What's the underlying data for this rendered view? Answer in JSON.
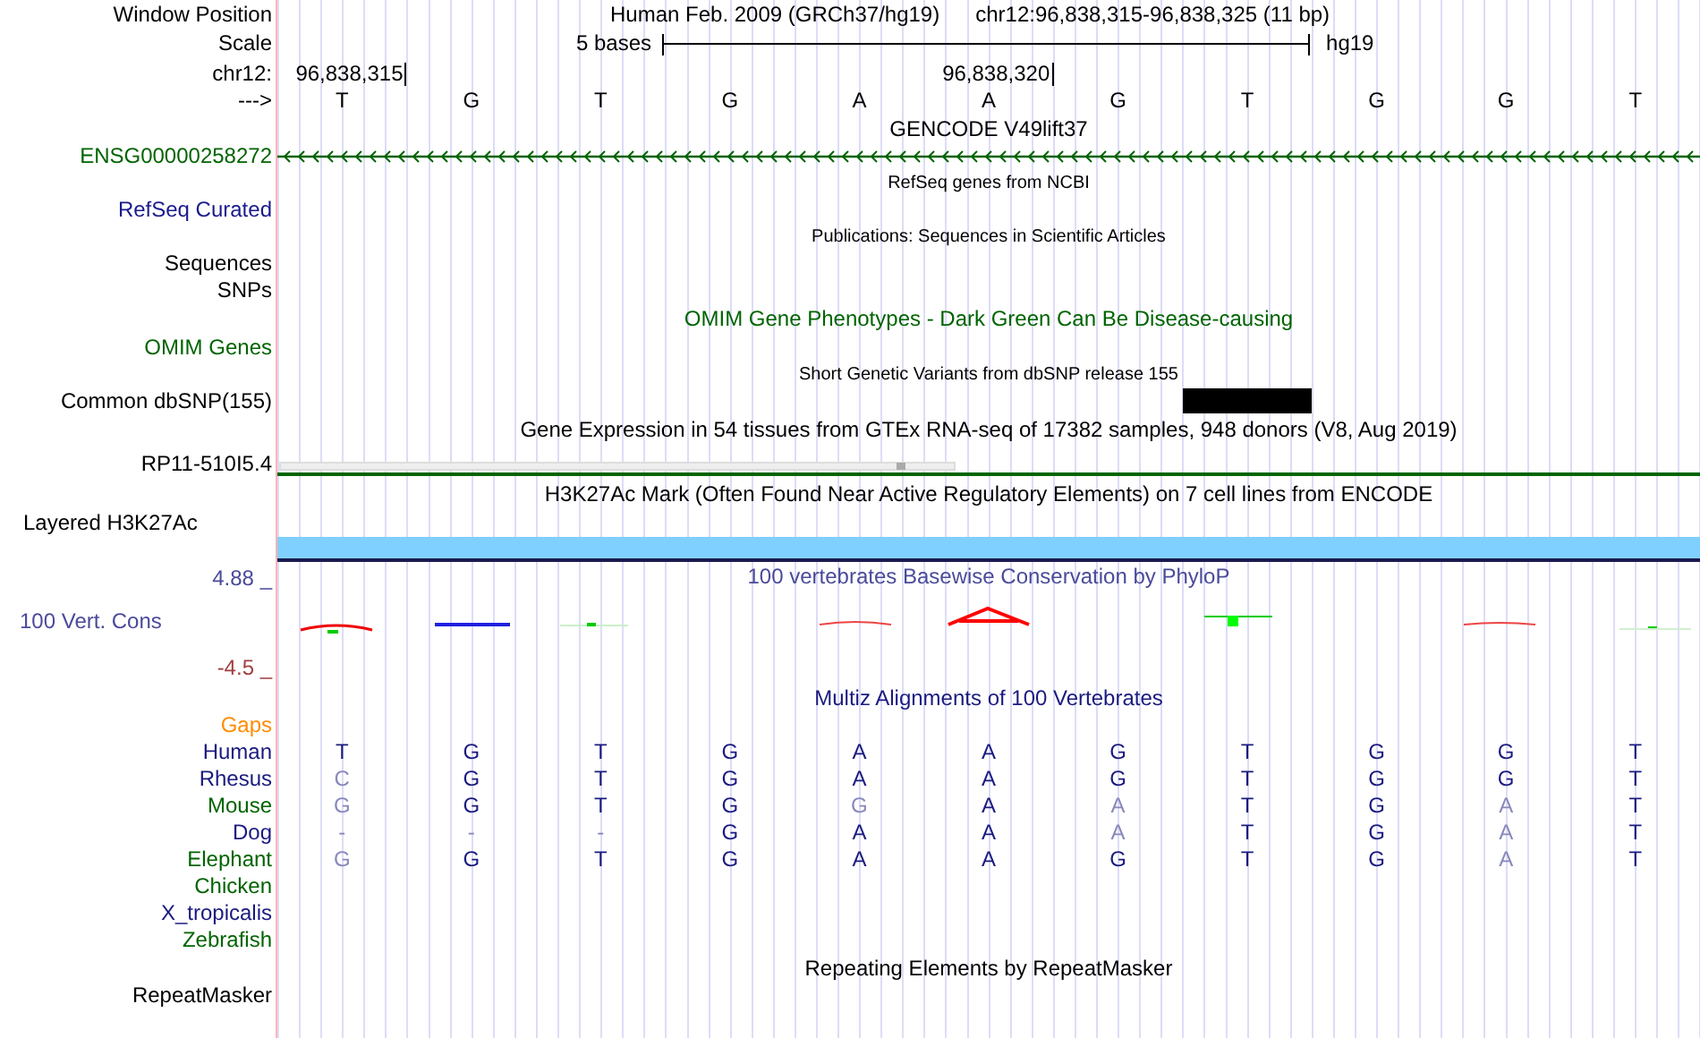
{
  "position": {
    "label": "Window Position",
    "assembly": "Human Feb. 2009 (GRCh37/hg19)",
    "range": "chr12:96,838,315-96,838,325 (11 bp)"
  },
  "scale": {
    "label": "Scale",
    "length": "5 bases",
    "genome": "hg19"
  },
  "coordinates": {
    "label": "chr12:",
    "start": "96,838,315",
    "middle": "96,838,320"
  },
  "sequence": {
    "label": "--->",
    "bases": [
      "T",
      "G",
      "T",
      "G",
      "A",
      "A",
      "G",
      "T",
      "G",
      "G",
      "T"
    ]
  },
  "tracks": [
    {
      "kind": "gene",
      "title": "GENCODE V49lift37",
      "labels": [
        "ENSG00000258272"
      ],
      "color": "#006400"
    },
    {
      "kind": "dense",
      "title": "RefSeq genes from NCBI",
      "labels": [
        "RefSeq Curated"
      ],
      "color": "#1a1a8c"
    },
    {
      "kind": "dense",
      "title": "Publications: Sequences in Scientific Articles",
      "labels": [
        "Sequences",
        "SNPs"
      ],
      "color": "#000000"
    },
    {
      "kind": "phenotype",
      "title": "OMIM Gene Phenotypes - Dark Green Can Be Disease-causing",
      "labels": [
        "OMIM Genes"
      ],
      "color": "#006400"
    },
    {
      "kind": "variant",
      "title": "Short Genetic Variants from dbSNP release 155",
      "labels": [
        "Common dbSNP(155)"
      ],
      "color": "#000000"
    },
    {
      "kind": "expression",
      "title": "Gene Expression in 54 tissues from GTEx RNA-seq of 17382 samples, 948 donors (V8, Aug 2019)",
      "labels": [
        "RP11-510I5.4"
      ],
      "color": "#000000"
    },
    {
      "kind": "signal",
      "title": "H3K27Ac Mark (Often Found Near Active Regulatory Elements) on 7 cell lines from ENCODE",
      "labels": [
        "Layered H3K27Ac"
      ],
      "color": "#000000"
    },
    {
      "kind": "wiggle",
      "title": "100 vertebrates Basewise Conservation by PhyloP",
      "labels": [
        "100 Vert. Cons"
      ],
      "color": "#4a4a9a",
      "ymax": "4.88 _",
      "ymin": "-4.5 _"
    },
    {
      "kind": "alignment",
      "title": "Multiz Alignments of 100 Vertebrates",
      "labels": [
        "Gaps"
      ],
      "color": "#1a1a80",
      "species": [
        {
          "name": "Human",
          "color": "#1a1a80",
          "bases": [
            {
              "base": "T",
              "match": true
            },
            {
              "base": "G",
              "match": true
            },
            {
              "base": "T",
              "match": true
            },
            {
              "base": "G",
              "match": true
            },
            {
              "base": "A",
              "match": true
            },
            {
              "base": "A",
              "match": true
            },
            {
              "base": "G",
              "match": true
            },
            {
              "base": "T",
              "match": true
            },
            {
              "base": "G",
              "match": true
            },
            {
              "base": "G",
              "match": true
            },
            {
              "base": "T",
              "match": true
            }
          ]
        },
        {
          "name": "Rhesus",
          "color": "#1a1a80",
          "bases": [
            {
              "base": "C",
              "match": false
            },
            {
              "base": "G",
              "match": true
            },
            {
              "base": "T",
              "match": true
            },
            {
              "base": "G",
              "match": true
            },
            {
              "base": "A",
              "match": true
            },
            {
              "base": "A",
              "match": true
            },
            {
              "base": "G",
              "match": true
            },
            {
              "base": "T",
              "match": true
            },
            {
              "base": "G",
              "match": true
            },
            {
              "base": "G",
              "match": true
            },
            {
              "base": "T",
              "match": true
            }
          ]
        },
        {
          "name": "Mouse",
          "color": "#006400",
          "bases": [
            {
              "base": "G",
              "match": false
            },
            {
              "base": "G",
              "match": true
            },
            {
              "base": "T",
              "match": true
            },
            {
              "base": "G",
              "match": true
            },
            {
              "base": "G",
              "match": false
            },
            {
              "base": "A",
              "match": true
            },
            {
              "base": "A",
              "match": false
            },
            {
              "base": "T",
              "match": true
            },
            {
              "base": "G",
              "match": true
            },
            {
              "base": "A",
              "match": false
            },
            {
              "base": "T",
              "match": true
            }
          ]
        },
        {
          "name": "Dog",
          "color": "#1a1a80",
          "bases": [
            {
              "base": "-",
              "match": false
            },
            {
              "base": "-",
              "match": false
            },
            {
              "base": "-",
              "match": false
            },
            {
              "base": "G",
              "match": true
            },
            {
              "base": "A",
              "match": true
            },
            {
              "base": "A",
              "match": true
            },
            {
              "base": "A",
              "match": false
            },
            {
              "base": "T",
              "match": true
            },
            {
              "base": "G",
              "match": true
            },
            {
              "base": "A",
              "match": false
            },
            {
              "base": "T",
              "match": true
            }
          ]
        },
        {
          "name": "Elephant",
          "color": "#006400",
          "bases": [
            {
              "base": "G",
              "match": false
            },
            {
              "base": "G",
              "match": true
            },
            {
              "base": "T",
              "match": true
            },
            {
              "base": "G",
              "match": true
            },
            {
              "base": "A",
              "match": true
            },
            {
              "base": "A",
              "match": true
            },
            {
              "base": "G",
              "match": true
            },
            {
              "base": "T",
              "match": true
            },
            {
              "base": "G",
              "match": true
            },
            {
              "base": "A",
              "match": false
            },
            {
              "base": "T",
              "match": true
            }
          ]
        },
        {
          "name": "Chicken",
          "color": "#006400"
        },
        {
          "name": "X_tropicalis",
          "color": "#1a1a80"
        },
        {
          "name": "Zebrafish",
          "color": "#006400"
        }
      ]
    },
    {
      "kind": "plain",
      "title": "Repeating Elements by RepeatMasker",
      "labels": [
        "RepeatMasker"
      ],
      "color": "#000000"
    }
  ]
}
